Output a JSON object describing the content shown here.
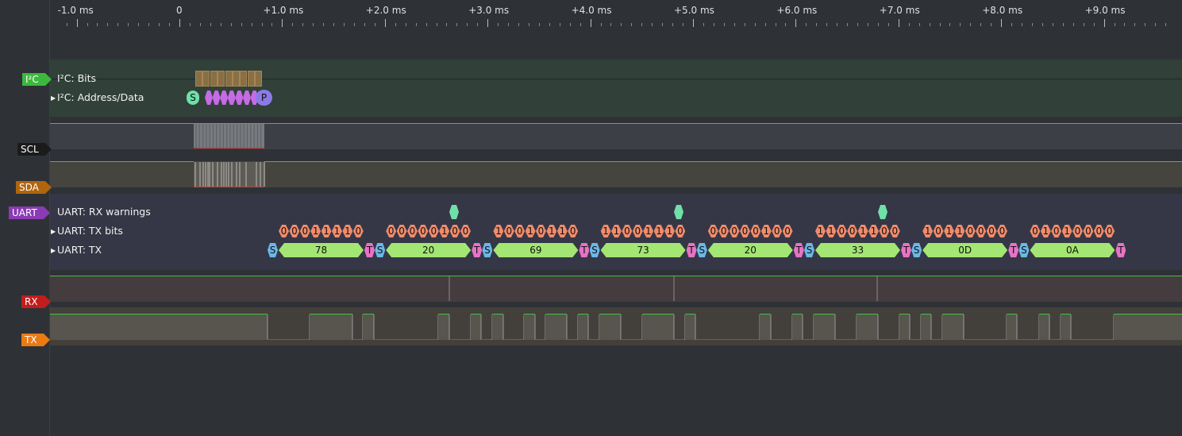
{
  "ruler": {
    "ticks": [
      "-1.0 ms",
      "0",
      "+1.0 ms",
      "+2.0 ms",
      "+3.0 ms",
      "+4.0 ms",
      "+5.0 ms",
      "+6.0 ms",
      "+7.0 ms",
      "+8.0 ms",
      "+9.0 ms"
    ]
  },
  "channels": {
    "i2c": {
      "tag": "I²C",
      "color": "#3cb93c"
    },
    "scl": {
      "tag": "SCL",
      "color": "#1b1b1b"
    },
    "sda": {
      "tag": "SDA",
      "color": "#b0650e"
    },
    "uart": {
      "tag": "UART",
      "color": "#8a3bb5"
    },
    "rx": {
      "tag": "RX",
      "color": "#c21d1d"
    },
    "tx": {
      "tag": "TX",
      "color": "#ec7a13"
    }
  },
  "rows": {
    "i2c_bits": "I²C: Bits",
    "i2c_addr": "I²C: Address/Data",
    "uart_rx_warnings": "UART: RX warnings",
    "uart_tx_bits": "UART: TX bits",
    "uart_tx": "UART: TX"
  },
  "i2c_markers": {
    "start": "S",
    "stop": "P"
  },
  "uart_frames": [
    {
      "start": "S",
      "bits": "00011110",
      "value": "78",
      "stop": "T"
    },
    {
      "start": "S",
      "bits": "00000100",
      "value": "20",
      "stop": "T"
    },
    {
      "start": "S",
      "bits": "10010110",
      "value": "69",
      "stop": "T"
    },
    {
      "start": "S",
      "bits": "11001110",
      "value": "73",
      "stop": "T"
    },
    {
      "start": "S",
      "bits": "00000100",
      "value": "20",
      "stop": "T"
    },
    {
      "start": "S",
      "bits": "11001100",
      "value": "33",
      "stop": "T"
    },
    {
      "start": "S",
      "bits": "10110000",
      "value": "0D",
      "stop": "T"
    },
    {
      "start": "S",
      "bits": "01010000",
      "value": "0A",
      "stop": "T"
    }
  ],
  "rx_warning_count": 3,
  "colors": {
    "signal_high": "#3ec23e",
    "signal_low": "#c23a3a",
    "bit": "#f08c6c",
    "data": "#a3e673",
    "start": "#6cb8e8",
    "stop": "#e873c6",
    "warning": "#6ee0a8"
  }
}
